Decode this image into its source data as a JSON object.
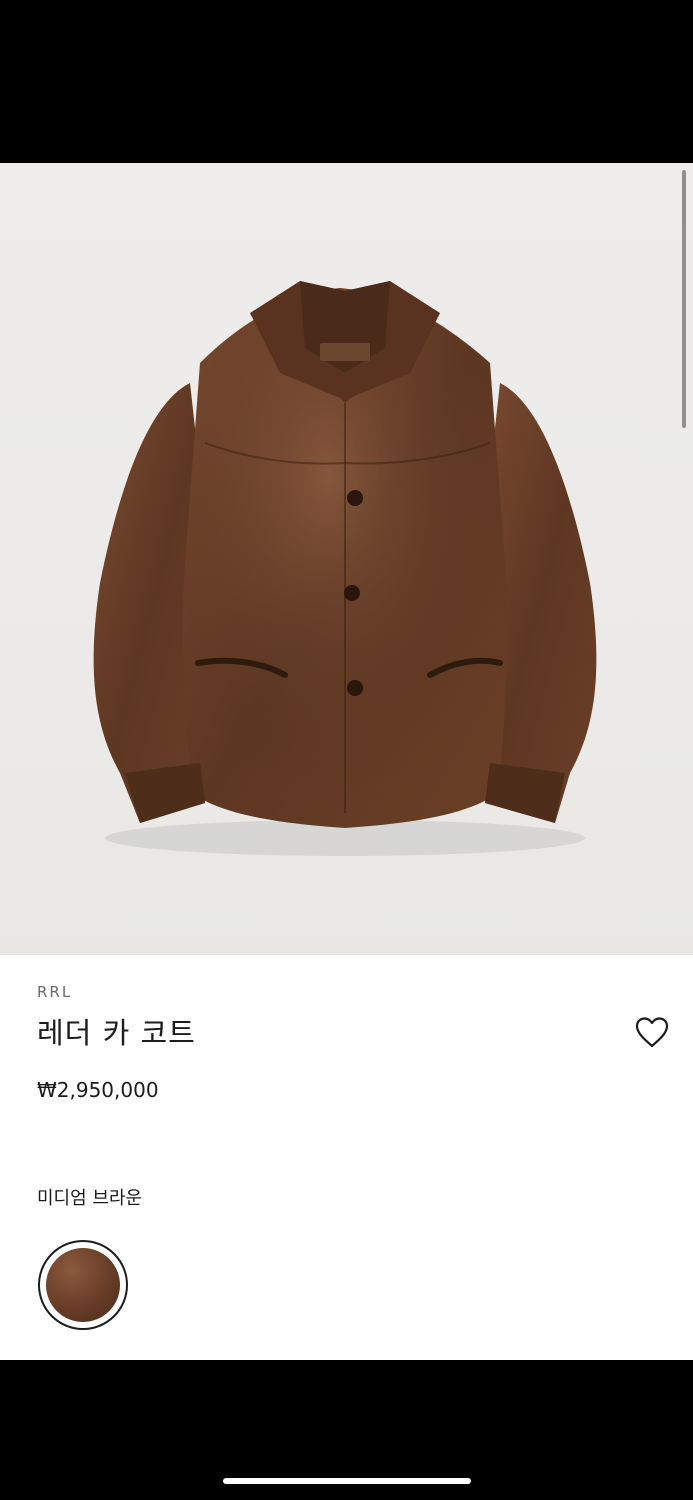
{
  "product": {
    "brand": "RRL",
    "name": "레더 카 코트",
    "price": "₩2,950,000",
    "color_name": "미디엄 브라운",
    "image_alt": "leather-jacket-image"
  },
  "icons": {
    "wishlist": "heart-outline-icon"
  },
  "colors": {
    "background": "#ffffff",
    "hero_background": "#ecebe9",
    "text": "#1c1c1c",
    "brand_text": "#6b6b6b",
    "leather": "#6e412a"
  }
}
